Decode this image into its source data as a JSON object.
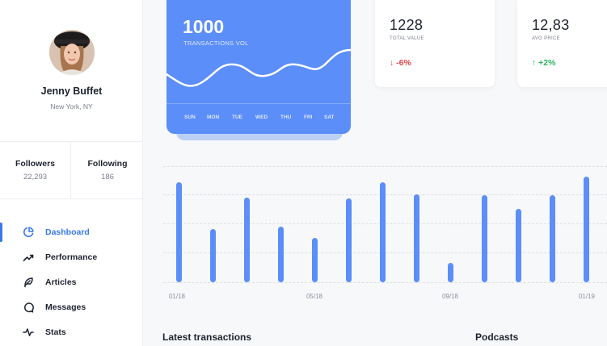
{
  "profile": {
    "name": "Jenny Buffet",
    "location": "New York, NY",
    "followers_label": "Followers",
    "followers_value": "22,293",
    "following_label": "Following",
    "following_value": "186"
  },
  "nav": [
    {
      "label": "Dashboard",
      "icon": "pie-chart-icon",
      "active": true
    },
    {
      "label": "Performance",
      "icon": "trending-up-icon",
      "active": false
    },
    {
      "label": "Articles",
      "icon": "feather-icon",
      "active": false
    },
    {
      "label": "Messages",
      "icon": "message-circle-icon",
      "active": false
    },
    {
      "label": "Stats",
      "icon": "activity-icon",
      "active": false
    }
  ],
  "transactions_card": {
    "value": "1000",
    "label": "TRANSACTIONS VOL",
    "days": [
      "SUN",
      "MON",
      "TUE",
      "WED",
      "THU",
      "FRI",
      "SAT"
    ]
  },
  "stat_cards": [
    {
      "value": "1228",
      "label": "TOTAL VALUE",
      "change": "↓ -6%",
      "trend": "down"
    },
    {
      "value": "12,83",
      "label": "AVG PRICE",
      "change": "↑ +2%",
      "trend": "up"
    }
  ],
  "chart_data": {
    "type": "bar",
    "x_ticks": [
      "01/18",
      "05/18",
      "09/18",
      "01/19"
    ],
    "values": [
      0.86,
      0.46,
      0.73,
      0.48,
      0.38,
      0.72,
      0.86,
      0.76,
      0.17,
      0.75,
      0.63,
      0.75,
      0.91
    ],
    "ylim": [
      0,
      1
    ],
    "grid": true,
    "bar_color": "#5b8ef8"
  },
  "sections": {
    "latest_transactions": "Latest transactions",
    "podcasts": "Podcasts"
  },
  "colors": {
    "accent": "#3a78ef",
    "card_blue": "#5b8ef8",
    "negative": "#e1454a",
    "positive": "#2cb55a"
  }
}
